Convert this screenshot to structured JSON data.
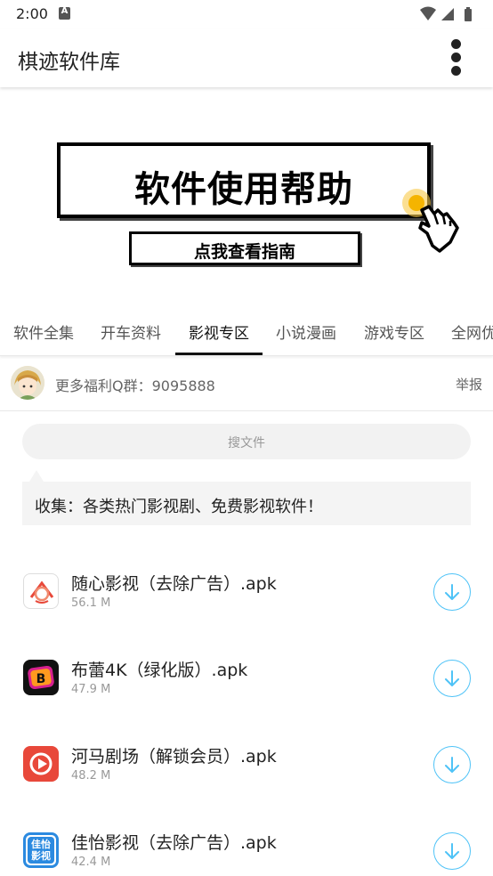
{
  "status": {
    "time": "2:00"
  },
  "appbar": {
    "title": "棋迹软件库"
  },
  "banner": {
    "main_text": "软件使用帮助",
    "sub_text": "点我查看指南"
  },
  "tabs": [
    {
      "label": "软件全集"
    },
    {
      "label": "开车资料"
    },
    {
      "label": "影视专区"
    },
    {
      "label": "小说漫画"
    },
    {
      "label": "游戏专区"
    },
    {
      "label": "全网优"
    }
  ],
  "active_tab": "影视专区",
  "notice": {
    "text": "更多福利Q群：9095888",
    "report": "举报"
  },
  "search": {
    "placeholder": "搜文件"
  },
  "description": "收集：各类热门影视剧、免费影视软件！",
  "files": [
    {
      "name": "随心影视（去除广告）.apk",
      "size": "56.1 M",
      "icon": "suixin-app-icon"
    },
    {
      "name": "布蕾4K（绿化版）.apk",
      "size": "47.9 M",
      "icon": "bulei-app-icon"
    },
    {
      "name": "河马剧场（解锁会员）.apk",
      "size": "48.2 M",
      "icon": "hema-app-icon"
    },
    {
      "name": "佳怡影视（去除广告）.apk",
      "size": "42.4 M",
      "icon": "jiayi-app-icon"
    }
  ],
  "jiayi_icon_text": "佳怡影视",
  "colors": {
    "accent": "#4fc3f7",
    "tab_active": "#111111",
    "hema_red": "#e8483a"
  }
}
